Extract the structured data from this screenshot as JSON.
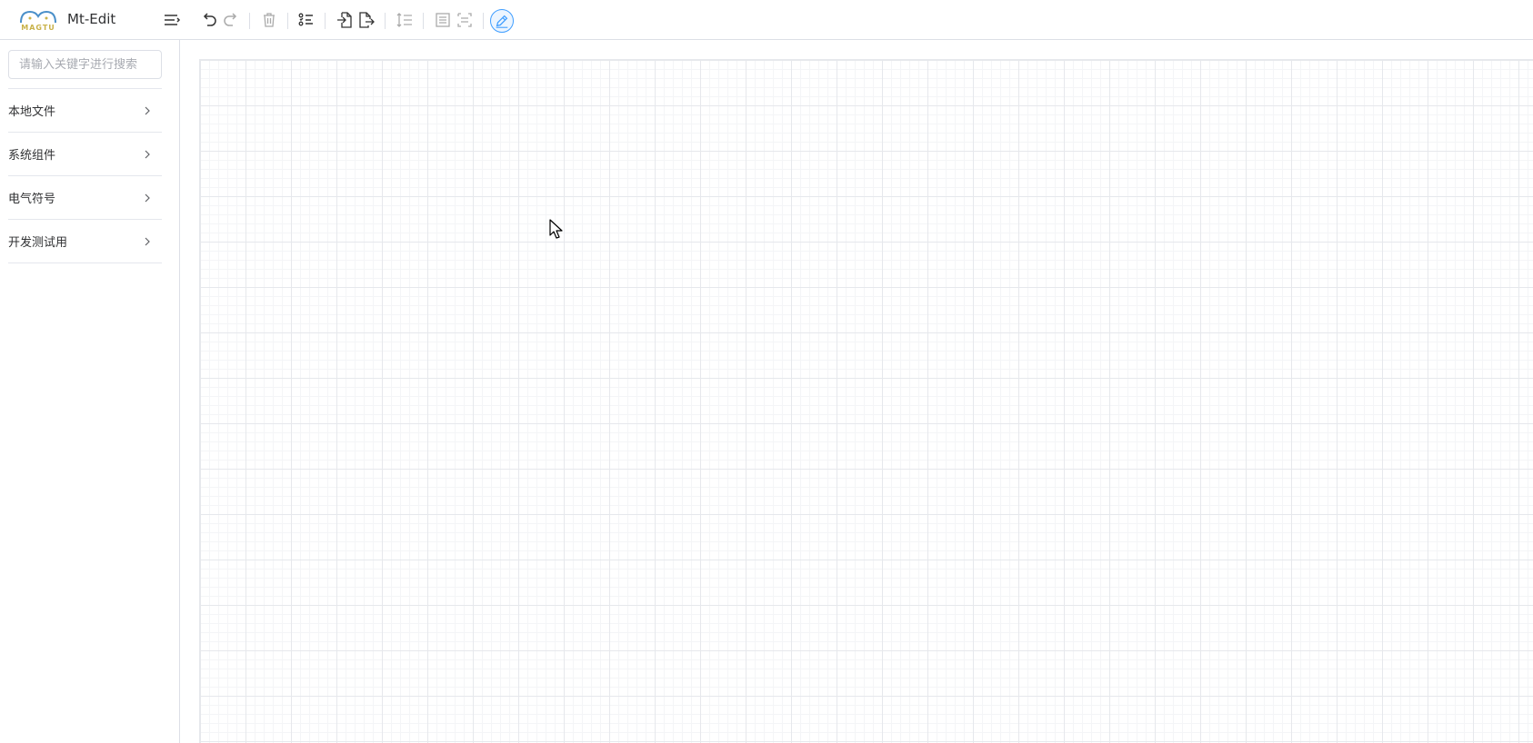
{
  "app": {
    "title": "Mt-Edit",
    "logo_text": "MAGTU"
  },
  "toolbar": {
    "buttons": [
      {
        "name": "menu-toggle",
        "icon": "menu-fold-icon"
      },
      {
        "name": "undo",
        "icon": "undo-icon"
      },
      {
        "name": "redo",
        "icon": "redo-icon"
      },
      {
        "name": "delete",
        "icon": "trash-icon"
      },
      {
        "name": "select-list",
        "icon": "list-check-icon"
      },
      {
        "name": "import",
        "icon": "file-import-icon"
      },
      {
        "name": "export",
        "icon": "file-export-icon"
      },
      {
        "name": "line-spacing",
        "icon": "line-spacing-icon"
      },
      {
        "name": "group",
        "icon": "group-icon"
      },
      {
        "name": "ungroup",
        "icon": "ungroup-icon"
      },
      {
        "name": "edit-mode",
        "icon": "pen-icon"
      }
    ]
  },
  "sidebar": {
    "search_placeholder": "请输入关键字进行搜索",
    "items": [
      {
        "label": "本地文件"
      },
      {
        "label": "系统组件"
      },
      {
        "label": "电气符号"
      },
      {
        "label": "开发测试用"
      }
    ]
  },
  "colors": {
    "accent": "#409eff",
    "border": "#dcdfe6",
    "grid_major": "#e6e8ec",
    "grid_minor": "#f4f5f7"
  }
}
